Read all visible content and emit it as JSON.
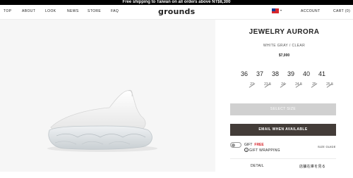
{
  "announcement": "Free shipping to Taiwan on all orders above NT$8,300",
  "nav": {
    "left": [
      {
        "label": "TOP"
      },
      {
        "label": "ABOUT"
      },
      {
        "label": "LOOK"
      },
      {
        "label": "NEWS"
      },
      {
        "label": "STORE"
      },
      {
        "label": "FAQ"
      }
    ],
    "logo": "grounds",
    "account": "ACCOUNT",
    "cart": "CART (0)"
  },
  "product": {
    "title": "JEWELRY AURORA",
    "color": "WHITE GRAY / CLEAR",
    "price": "$7,000",
    "sizes": [
      "36",
      "37",
      "38",
      "39",
      "40",
      "41"
    ],
    "jp_sizes": [
      "23",
      "23.5",
      "24",
      "24.5",
      "25",
      "25.5"
    ],
    "select_size": "SELECT SIZE",
    "email_when_available": "EMAIL WHEN AVAILABLE",
    "gift": "GIFT",
    "gift_badge": "FREE",
    "gift_wrapping": "GIFT WRAPPING",
    "size_guide": "SIZE GUIDE",
    "tab_detail": "DETAIL",
    "tab_store_stock": "店舗在庫を見る"
  },
  "gallery": {
    "slides": 5,
    "active": 0
  },
  "colors": {
    "accent_dark": "#433c38",
    "disabled": "#d0d0d0",
    "free_badge": "#d8262c"
  }
}
